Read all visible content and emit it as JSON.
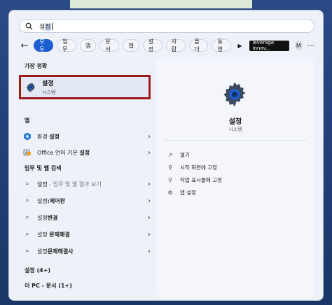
{
  "search": {
    "query_prefix": "설",
    "query_highlight": "정"
  },
  "filters": {
    "chips": [
      "모두",
      "업무",
      "앱",
      "문서",
      "웹",
      "설정",
      "사람",
      "폴더",
      "동영"
    ],
    "active_index": 0,
    "leverage_label": "leverage innov...",
    "avatar_initial": "M"
  },
  "left": {
    "best_match_header": "가장 정확",
    "best_match": {
      "title": "설정",
      "subtitle": "시스템"
    },
    "apps_header": "앱",
    "apps": [
      {
        "prefix": "환경 ",
        "bold": "설정",
        "suffix": ""
      },
      {
        "prefix": "Office 언어 기본 ",
        "bold": "설정",
        "suffix": ""
      }
    ],
    "web_header": "업무 및 웹 검색",
    "web": [
      {
        "bold": "",
        "prefix": "설정",
        "dim": " - 업무 및 웹 결과 보기"
      },
      {
        "bold": "",
        "prefix": "설정",
        "dim": "",
        "bold_suffix": ":제어판"
      },
      {
        "bold": "",
        "prefix": "설정",
        "dim": "",
        "bold_suffix": "변경"
      },
      {
        "bold": "",
        "prefix": "설정 ",
        "dim": "",
        "bold_suffix": "문제해결"
      },
      {
        "bold": "",
        "prefix": "설정",
        "dim": "",
        "bold_suffix": "문제해결사"
      }
    ],
    "settings_count": "설정 (4+)",
    "docs_count": "이 PC - 문서 (1+)"
  },
  "right": {
    "title": "설정",
    "subtitle": "시스템",
    "actions": [
      {
        "icon": "open-icon",
        "label": "열기"
      },
      {
        "icon": "pin-start-icon",
        "label": "시작 화면에 고정"
      },
      {
        "icon": "pin-taskbar-icon",
        "label": "작업 표시줄에 고정"
      },
      {
        "icon": "gear-icon",
        "label": "앱 설정"
      }
    ]
  },
  "colors": {
    "accent": "#1e5fd0",
    "highlight_border": "#9c1a1a",
    "gear": "#3b4a5e"
  }
}
